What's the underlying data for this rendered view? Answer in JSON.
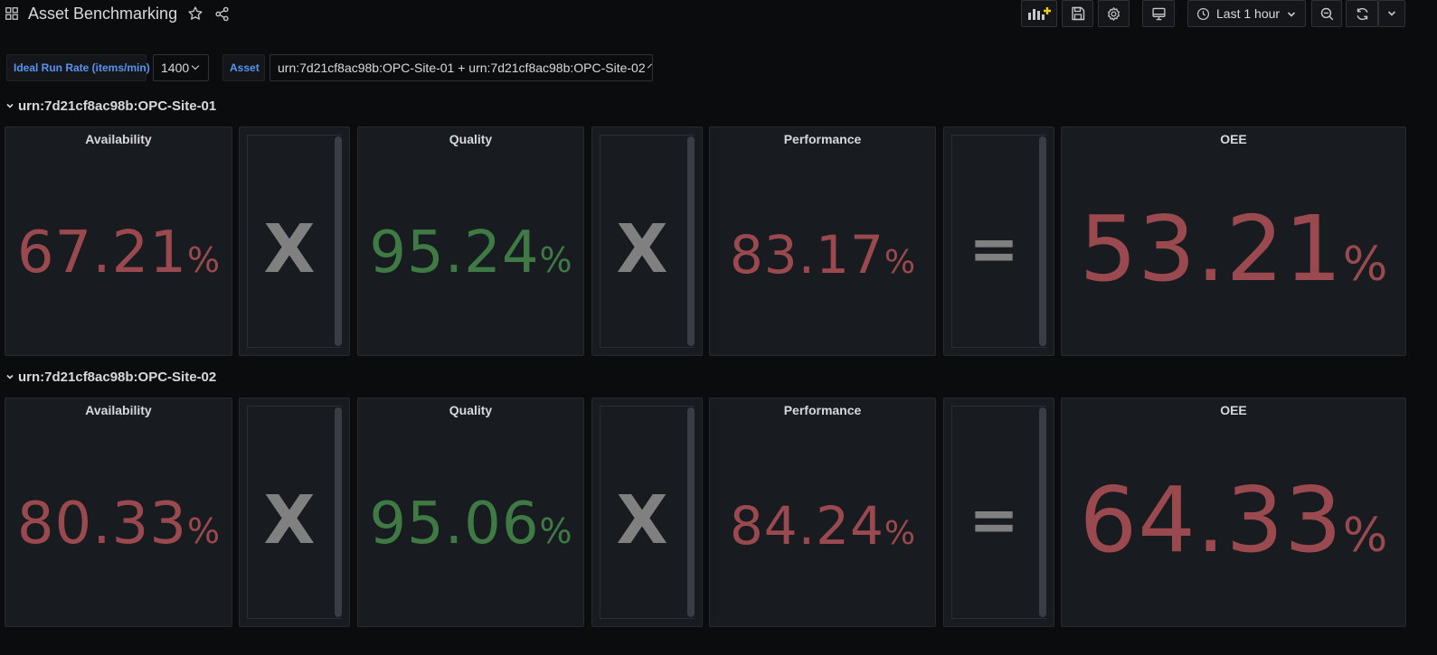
{
  "dashboard": {
    "title": "Asset Benchmarking"
  },
  "toolbar": {
    "time_range": "Last 1 hour",
    "icons": [
      "add-panel-icon",
      "save-icon",
      "settings-icon",
      "tv-mode-icon",
      "clock-icon",
      "zoom-out-icon",
      "refresh-icon",
      "chevron-down-icon"
    ]
  },
  "variables": {
    "run_rate": {
      "label": "Ideal Run Rate (items/min)",
      "value": "1400"
    },
    "asset": {
      "label": "Asset",
      "value": "urn:7d21cf8ac98b:OPC-Site-01 + urn:7d21cf8ac98b:OPC-Site-02"
    }
  },
  "rows": [
    {
      "title": "urn:7d21cf8ac98b:OPC-Site-01",
      "availability": {
        "title": "Availability",
        "value": "67.21",
        "unit": "%"
      },
      "op1": "X",
      "quality": {
        "title": "Quality",
        "value": "95.24",
        "unit": "%"
      },
      "op2": "X",
      "performance": {
        "title": "Performance",
        "value": "83.17",
        "unit": "%"
      },
      "op3": "=",
      "oee": {
        "title": "OEE",
        "value": "53.21",
        "unit": "%"
      }
    },
    {
      "title": "urn:7d21cf8ac98b:OPC-Site-02",
      "availability": {
        "title": "Availability",
        "value": "80.33",
        "unit": "%"
      },
      "op1": "X",
      "quality": {
        "title": "Quality",
        "value": "95.06",
        "unit": "%"
      },
      "op2": "X",
      "performance": {
        "title": "Performance",
        "value": "84.24",
        "unit": "%"
      },
      "op3": "=",
      "oee": {
        "title": "OEE",
        "value": "64.33",
        "unit": "%"
      }
    }
  ],
  "colors": {
    "bad": "#9a4a4f",
    "good": "#3f7a45",
    "operator": "#808080",
    "variable_label": "#5794f2",
    "accent": "#f2cc0c"
  }
}
